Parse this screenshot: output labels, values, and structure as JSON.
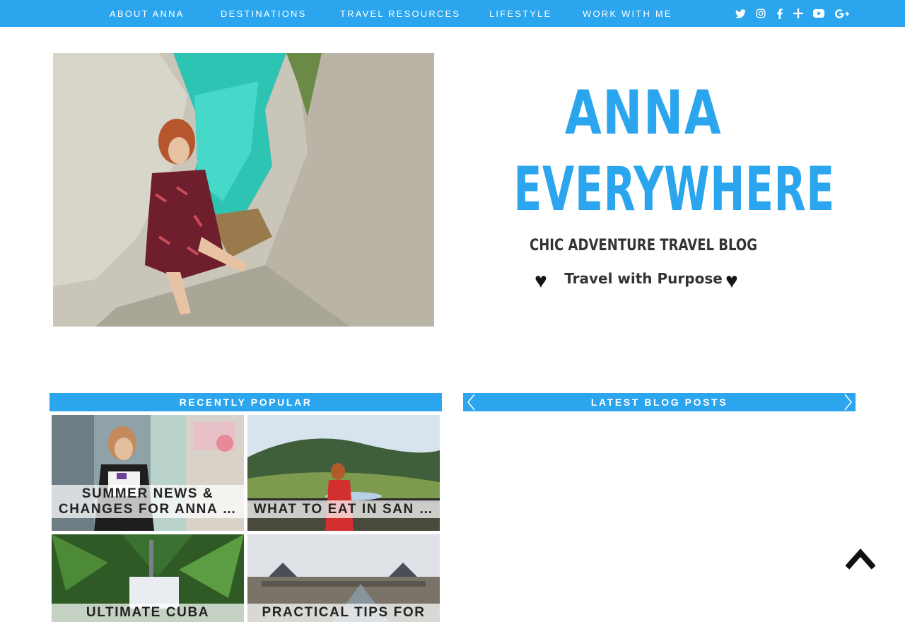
{
  "nav": {
    "items": [
      {
        "label": "ABOUT ANNA"
      },
      {
        "label": "DESTINATIONS"
      },
      {
        "label": "TRAVEL RESOURCES"
      },
      {
        "label": "LIFESTYLE"
      },
      {
        "label": "WORK WITH ME"
      }
    ],
    "social": [
      "twitter-icon",
      "instagram-icon",
      "facebook-icon",
      "bloglovin-icon",
      "youtube-icon",
      "google-plus-icon"
    ],
    "background": "#2aa5ee"
  },
  "logo": {
    "line1": "ANNA",
    "line2": "EVERYWHERE",
    "tagline": "CHIC ADVENTURE TRAVEL BLOG",
    "motto": "Travel with Purpose",
    "color": "#2aa5ee"
  },
  "popular": {
    "title": "RECENTLY POPULAR",
    "tiles": [
      {
        "line1": "SUMMER NEWS &",
        "line2": "CHANGES FOR ANNA …"
      },
      {
        "line1": "WHAT TO EAT IN SAN …"
      },
      {
        "line1": "ULTIMATE CUBA"
      },
      {
        "line1": "PRACTICAL TIPS FOR"
      }
    ]
  },
  "latest": {
    "title": "LATEST BLOG POSTS"
  },
  "accent": "#2aa5ee"
}
